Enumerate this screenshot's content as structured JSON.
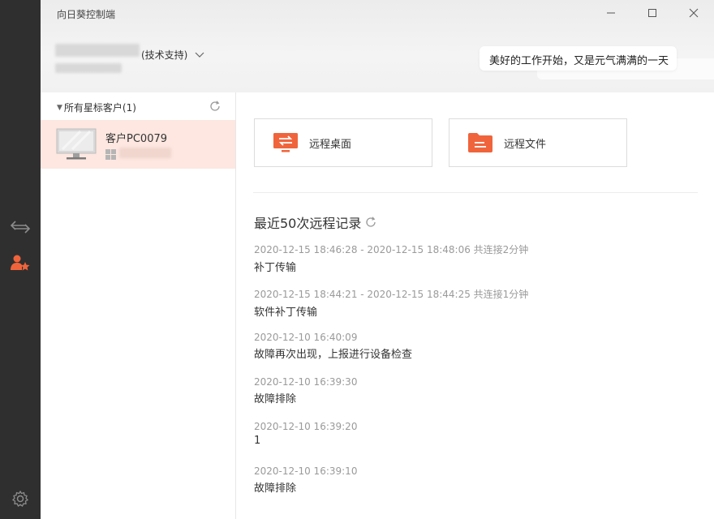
{
  "app": {
    "title": "向日葵控制端"
  },
  "user": {
    "role": "(技术支持)"
  },
  "banner": {
    "message": "美好的工作开始，又是元气满满的一天"
  },
  "clients": {
    "group_label": "所有星标客户(1)",
    "items": [
      {
        "name": "客户PC0079"
      }
    ]
  },
  "actions": {
    "remote_desktop": "远程桌面",
    "remote_file": "远程文件"
  },
  "records": {
    "title": "最近50次远程记录",
    "items": [
      {
        "time": "2020-12-15 18:46:28 - 2020-12-15 18:48:06 共连接2分钟",
        "desc": "补丁传输"
      },
      {
        "time": "2020-12-15 18:44:21 - 2020-12-15 18:44:25 共连接1分钟",
        "desc": "软件补丁传输"
      },
      {
        "time": "2020-12-10 16:40:09",
        "desc": "故障再次出现，上报进行设备检查"
      },
      {
        "time": "2020-12-10 16:39:30",
        "desc": "故障排除"
      },
      {
        "time": "2020-12-10 16:39:20",
        "desc": "1"
      },
      {
        "time": "2020-12-10 16:39:10",
        "desc": "故障排除"
      }
    ]
  },
  "colors": {
    "accent": "#f0643c",
    "rail": "#2f2f2f",
    "selected": "#fde7e0"
  }
}
